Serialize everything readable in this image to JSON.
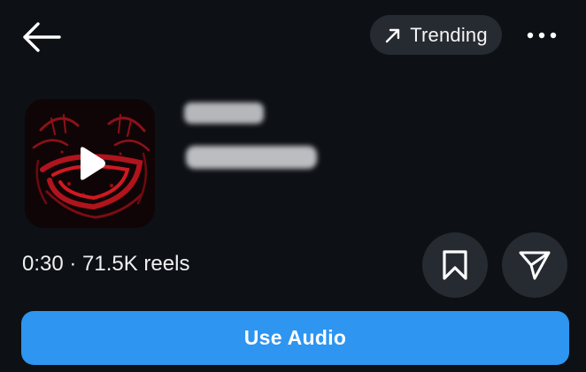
{
  "header": {
    "back_icon": "arrow-left-icon",
    "trending_label": "Trending",
    "trending_icon": "arrow-up-right-icon",
    "more_icon": "more-horizontal-icon"
  },
  "audio": {
    "cover_icon": "play-icon",
    "duration": "0:30",
    "separator": "·",
    "reels_count": "71.5K reels",
    "meta_text": "0:30 · 71.5K reels"
  },
  "actions": {
    "save_icon": "bookmark-icon",
    "share_icon": "send-icon",
    "use_audio_label": "Use Audio"
  },
  "colors": {
    "background": "#0d1015",
    "surface": "#262a31",
    "accent": "#2e95f0",
    "text": "#f5f5f5"
  }
}
